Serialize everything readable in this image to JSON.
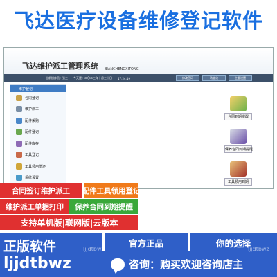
{
  "banner": {
    "title": "飞达医疗设备维修登记软件"
  },
  "app": {
    "title": "飞达维护派工管理系统",
    "subtitle": "BIANCHENGXITONG",
    "status": [
      "当前操作员：张三",
      "今天是：二〇二三年十月三十日",
      "17:24:19"
    ],
    "top_buttons": [
      "修改密码",
      "功能化",
      "主题设置"
    ],
    "sidebar_header": "维护登记",
    "sidebar_items": [
      {
        "label": "合同登记",
        "icon": "contract-icon",
        "color": "#c9a24a"
      },
      {
        "label": "维护派工",
        "icon": "dispatch-icon",
        "color": "#7a8fa6"
      },
      {
        "label": "配件采购",
        "icon": "cart-icon",
        "color": "#4a88c9"
      },
      {
        "label": "配件登记",
        "icon": "register-icon",
        "color": "#6aa84f"
      },
      {
        "label": "配件库存",
        "icon": "warehouse-icon",
        "color": "#8e6bb5"
      },
      {
        "label": "工具登记",
        "icon": "tool-icon",
        "color": "#c96a4a"
      },
      {
        "label": "工具领用借还",
        "icon": "toolbox-icon",
        "color": "#d0a63a"
      },
      {
        "label": "系统设置",
        "icon": "settings-icon",
        "color": "#4a9bc9"
      }
    ],
    "desktop": [
      {
        "label": "合同到期提醒",
        "icon": "pencil-icon"
      },
      {
        "label": "保养合同到期提醒",
        "icon": "monitor-icon"
      },
      {
        "label": "工具领用到期",
        "icon": "book-icon"
      }
    ]
  },
  "features": {
    "row1": [
      "合同签订维护派工",
      "配件工具领用登记"
    ],
    "row2": [
      "维护派工单据打印",
      "保养合同到期提醒"
    ],
    "row3": "支持单机版|联网版|云版本"
  },
  "footer": {
    "genuine": "正版软件",
    "brand": "ljjdtbwz",
    "official": "官方正品",
    "choice": "你的选择",
    "consult": "咨询：购买欢迎咨询店主",
    "watermark": "ljjdtbwz"
  },
  "colors": {
    "blue": "#1a6fe0",
    "red": "#e03030",
    "orange": "#f07a1a",
    "green": "#3aa83a",
    "darkblue": "#2f5fc8"
  }
}
